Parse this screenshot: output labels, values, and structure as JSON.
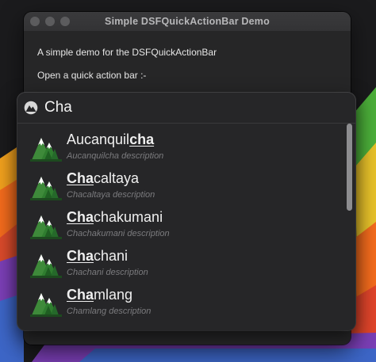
{
  "window": {
    "title": "Simple DSFQuickActionBar Demo",
    "intro_text": "A simple demo for the DSFQuickActionBar",
    "open_text": "Open a quick action bar :-"
  },
  "quick_action_bar": {
    "search_value": "Cha",
    "search_icon": "mountain-icon",
    "result_icon": "mountain-trees-icon",
    "scroll_position": 0.0,
    "results": [
      {
        "prefix": "Aucanquil",
        "match": "cha",
        "suffix": "",
        "description": "Aucanquilcha description"
      },
      {
        "prefix": "",
        "match": "Cha",
        "suffix": "caltaya",
        "description": "Chacaltaya description"
      },
      {
        "prefix": "",
        "match": "Cha",
        "suffix": "chakumani",
        "description": "Chachakumani description"
      },
      {
        "prefix": "",
        "match": "Cha",
        "suffix": "chani",
        "description": "Chachani description"
      },
      {
        "prefix": "",
        "match": "Cha",
        "suffix": "mlang",
        "description": "Chamlang description"
      }
    ]
  },
  "colors": {
    "window_bg": "#262627",
    "panel_bg": "#262628",
    "text_primary": "#efefef",
    "text_secondary": "#7b7b7e",
    "tree_green": "#2f7d2f",
    "wallpaper_orange": "#f26b1d",
    "wallpaper_green": "#4caf3a",
    "wallpaper_purple": "#7b3fb6"
  }
}
